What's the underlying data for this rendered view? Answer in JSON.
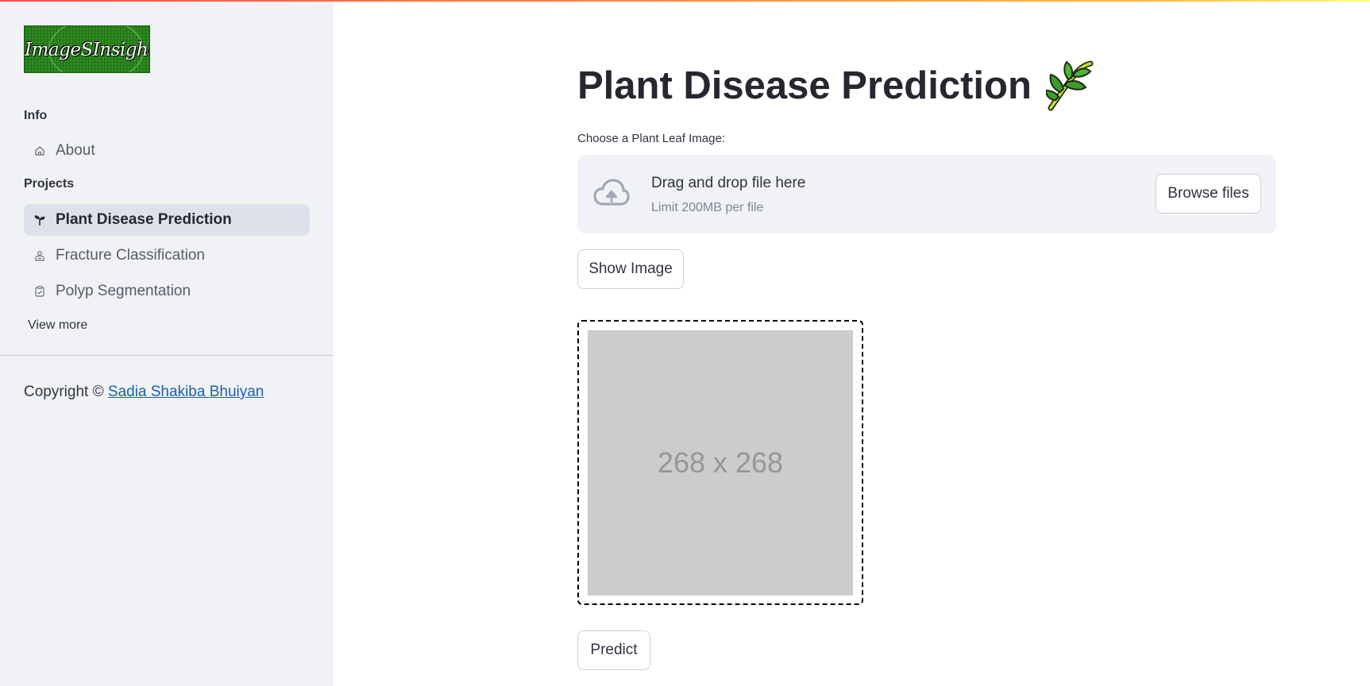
{
  "sidebar": {
    "logo_text": "ImageSInsight",
    "sections": [
      {
        "title": "Info"
      },
      {
        "title": "Projects"
      }
    ],
    "items": [
      {
        "label": "About",
        "icon": "house-icon"
      },
      {
        "label": "Plant Disease Prediction",
        "icon": "sprout-icon",
        "active": true
      },
      {
        "label": "Fracture Classification",
        "icon": "person-badge-icon"
      },
      {
        "label": "Polyp Segmentation",
        "icon": "clipboard-check-icon"
      }
    ],
    "view_more": "View more",
    "copyright_prefix": "Copyright ©",
    "copyright_name": "Sadia Shakiba Bhuiyan"
  },
  "main": {
    "title": "Plant Disease Prediction",
    "title_icon": "leafy-green-emoji",
    "upload_label": "Choose a Plant Leaf Image:",
    "dropzone": {
      "title": "Drag and drop file here",
      "limit": "Limit 200MB per file",
      "browse_label": "Browse files",
      "icon": "cloud-upload-icon"
    },
    "show_image_label": "Show Image",
    "placeholder_text": "268 x 268",
    "predict_label": "Predict"
  },
  "colors": {
    "sidebar_bg": "#f0f2f6",
    "active_item_bg": "#dde1ea",
    "link": "#1a5fb4",
    "placeholder_bg": "#cccccc",
    "top_gradient_start": "#ff4b4b",
    "top_gradient_end": "#fffd80"
  }
}
